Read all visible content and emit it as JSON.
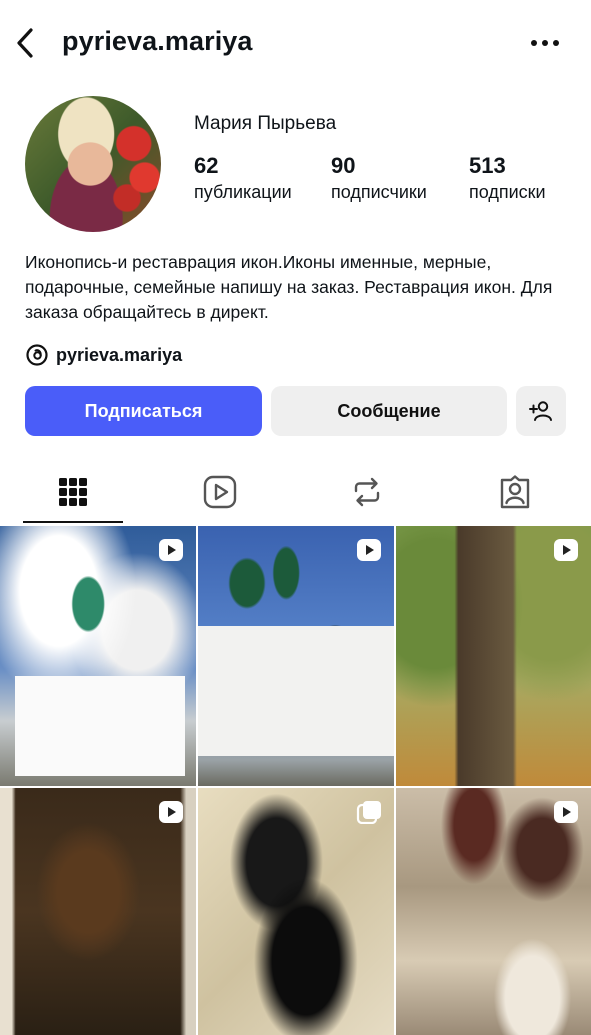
{
  "header": {
    "username": "pyrieva.mariya",
    "back_icon": "chevron-left-icon",
    "more_icon": "more-horizontal-icon"
  },
  "profile": {
    "display_name": "Мария Пырьева",
    "stats": [
      {
        "value": "62",
        "label": "публикации"
      },
      {
        "value": "90",
        "label": "подписчики"
      },
      {
        "value": "513",
        "label": "подписки"
      }
    ],
    "bio": "Иконопись-и реставрация икон.Иконы именные, мерные, подарочные, семейные напишу на заказ. Реставрация икон. Для заказа обращайтесь в директ.",
    "threads_handle": "pyrieva.mariya"
  },
  "actions": {
    "follow_label": "Подписаться",
    "message_label": "Сообщение",
    "add_user_icon": "add-user-icon",
    "follow_color": "#4a5df9"
  },
  "tabs": [
    {
      "name": "grid",
      "icon": "grid-icon",
      "active": true
    },
    {
      "name": "reels",
      "icon": "reels-icon",
      "active": false
    },
    {
      "name": "reposts",
      "icon": "repost-icon",
      "active": false
    },
    {
      "name": "tagged",
      "icon": "tagged-icon",
      "active": false
    }
  ],
  "posts": [
    {
      "type": "reel",
      "subject": "monastery-cathedral"
    },
    {
      "type": "reel",
      "subject": "white-kremlin"
    },
    {
      "type": "reel",
      "subject": "old-oak-tree"
    },
    {
      "type": "reel",
      "subject": "old-icon"
    },
    {
      "type": "carousel",
      "subject": "black-cat"
    },
    {
      "type": "reel",
      "subject": "fresco-restoration"
    }
  ]
}
